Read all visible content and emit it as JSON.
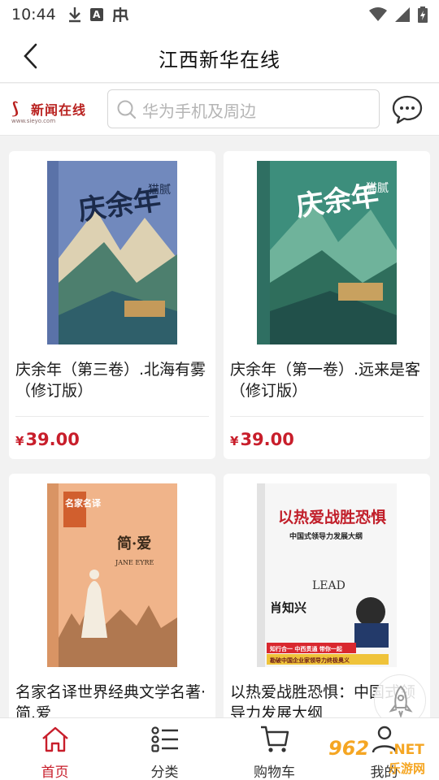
{
  "status_bar": {
    "time": "10:44",
    "icons_left": [
      "download-icon",
      "a-box-icon",
      "app-icon"
    ],
    "icons_right": [
      "wifi-icon",
      "signal-icon",
      "battery-icon"
    ]
  },
  "header": {
    "title": "江西新华在线",
    "back_icon": "chevron-left-icon"
  },
  "search_bar": {
    "logo_text": "新闻在线",
    "logo_sub": "www.sieyo.com",
    "placeholder": "华为手机及周边",
    "message_icon": "chat-bubble-icon"
  },
  "products": [
    {
      "title": "庆余年（第三卷）.北海有雾（修订版）",
      "price_symbol": "¥",
      "price": "39.00",
      "cover": {
        "title": "庆余年",
        "author": "猫腻",
        "bg": "#6f86b8"
      }
    },
    {
      "title": "庆余年（第一卷）.远来是客（修订版）",
      "price_symbol": "¥",
      "price": "39.00",
      "cover": {
        "title": "庆余年",
        "author": "猫腻",
        "bg": "#3c8b7a"
      }
    },
    {
      "title": "名家名译世界经典文学名著·简.爱",
      "price_symbol": "",
      "price": "",
      "cover": {
        "title": "简·爱",
        "author": "JANE EYRE",
        "badge": "名家名译",
        "bg": "#e9a476"
      }
    },
    {
      "title": "以热爱战胜恐惧：中国式领导力发展大纲",
      "price_symbol": "",
      "price": "",
      "cover": {
        "title": "以热爱战胜恐惧",
        "subtitle": "中国式领导力发展大纲",
        "author": "肖知兴",
        "lead": "LEAD",
        "band1": "知行合一  中西贯通  带你一起",
        "band2": "勘破中国企业家领导力终极奥义",
        "bg": "#f5f5f5"
      }
    }
  ],
  "bottom_nav": [
    {
      "label": "首页",
      "icon": "home-icon",
      "active": true
    },
    {
      "label": "分类",
      "icon": "list-icon",
      "active": false
    },
    {
      "label": "购物车",
      "icon": "cart-icon",
      "active": false
    },
    {
      "label": "我的",
      "icon": "user-icon",
      "active": false
    }
  ],
  "watermark": {
    "number": "962",
    "domain": ".NET",
    "name": "乐游网"
  },
  "colors": {
    "accent": "#c81e2b",
    "background": "#f2f2f2"
  }
}
